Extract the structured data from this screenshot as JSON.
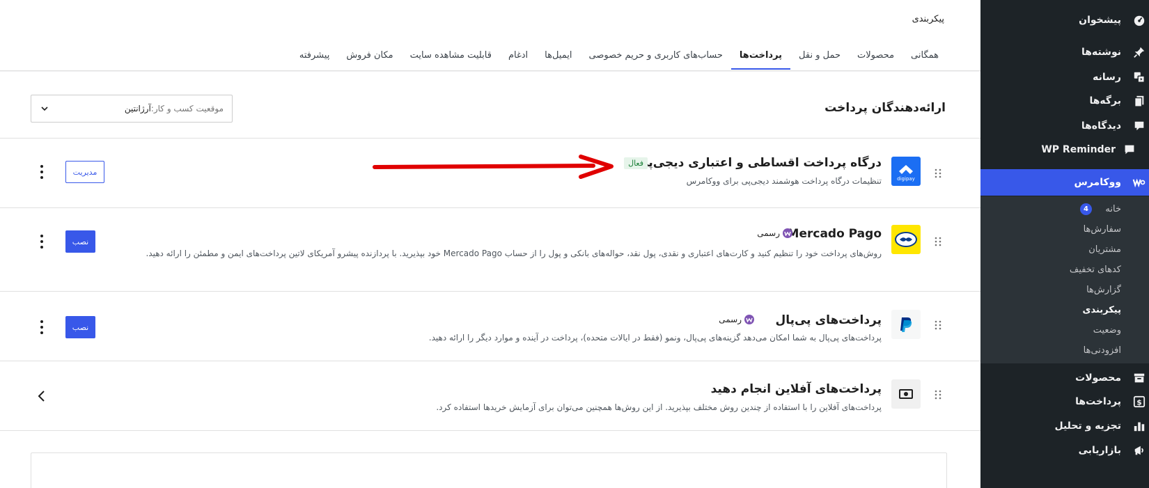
{
  "sidebar": {
    "items": [
      {
        "label": "پیشخوان",
        "icon": "dashboard-icon"
      },
      {
        "label": "نوشته‌ها",
        "icon": "pin-icon"
      },
      {
        "label": "رسانه",
        "icon": "media-icon"
      },
      {
        "label": "برگه‌ها",
        "icon": "pages-icon"
      },
      {
        "label": "دیدگاه‌ها",
        "icon": "comments-icon"
      },
      {
        "label": "WP Reminder",
        "icon": "chat-icon"
      },
      {
        "label": "ووکامرس",
        "icon": "woo-icon"
      },
      {
        "label": "محصولات",
        "icon": "archive-icon"
      },
      {
        "label": "پرداخت‌ها",
        "icon": "dollar-icon"
      },
      {
        "label": "تجزیه و تحلیل",
        "icon": "chart-icon"
      },
      {
        "label": "بازاریابی",
        "icon": "megaphone-icon"
      }
    ],
    "submenu": [
      {
        "label": "خانه"
      },
      {
        "label": "سفارش‌ها"
      },
      {
        "label": "مشتریان"
      },
      {
        "label": "کدهای تخفیف"
      },
      {
        "label": "گزارش‌ها"
      },
      {
        "label": "پیکربندی"
      },
      {
        "label": "وضعیت"
      },
      {
        "label": "افزودنی‌ها"
      }
    ],
    "home_count": "4"
  },
  "header": {
    "title": "پیکربندی",
    "tabs": [
      {
        "label": "همگانی"
      },
      {
        "label": "محصولات"
      },
      {
        "label": "حمل و نقل"
      },
      {
        "label": "پرداخت‌ها"
      },
      {
        "label": "حساب‌های کاربری و حریم خصوصی"
      },
      {
        "label": "ایمیل‌ها"
      },
      {
        "label": "ادغام"
      },
      {
        "label": "قابلیت مشاهده سایت"
      },
      {
        "label": "مکان فروش"
      },
      {
        "label": "پیشرفته"
      }
    ]
  },
  "section": {
    "title": "ارائه‌دهندگان پرداخت",
    "location_prefix": "موقعیت کسب و کار:",
    "location_value": "آرژانتین"
  },
  "gateways": [
    {
      "title": "درگاه پرداخت اقساطی و اعتباری دیجی‌پی",
      "badge": "فعال",
      "desc": "تنظیمات درگاه پرداخت هوشمند دیجی‌پی برای ووکامرس",
      "button": "مدیریت",
      "logo_text": "digipay"
    },
    {
      "title": "Mercado Pago",
      "badge": "رسمی",
      "desc": "روش‌های پرداخت خود را تنظیم کنید و کارت‌های اعتباری و نقدی، پول نقد، حواله‌های بانکی و پول را از حساب Mercado Pago خود بپذیرید. با پردازنده پیشرو آمریکای لاتین پرداخت‌های ایمن و مطمئن را ارائه دهید.",
      "button": "نصب"
    },
    {
      "title": "پرداخت‌های پی‌پال",
      "badge": "رسمی",
      "desc": "پرداخت‌های پی‌پال به شما امکان می‌دهد گزینه‌های پی‌پال، ونمو (فقط در ایالات متحده)، پرداخت در آینده و موارد دیگر را ارائه دهید.",
      "button": "نصب"
    },
    {
      "title": "پرداخت‌های آفلاین انجام دهید",
      "desc": "پرداخت‌های آفلاین را با استفاده از چندین روش مختلف بپذیرید. از این روش‌ها همچنین می‌توان برای آزمایش خریدها استفاده کرد."
    }
  ],
  "colors": {
    "accent": "#3858e9",
    "sidebar_bg": "#1d2327",
    "active_badge_bg": "#e6f4ea",
    "arrow": "#e00000"
  }
}
